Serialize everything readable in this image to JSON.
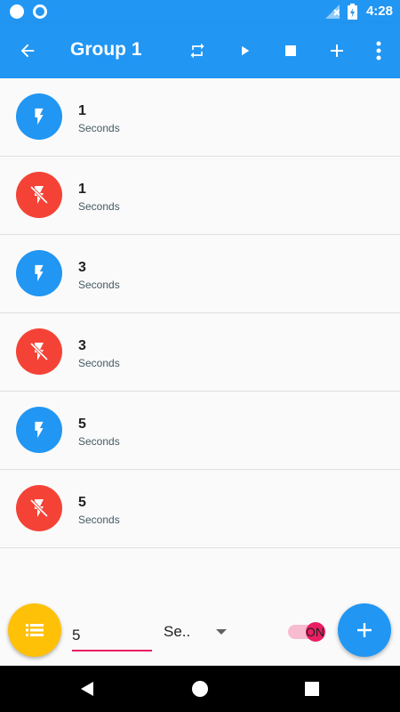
{
  "status_bar": {
    "time": "4:28",
    "left_icons": [
      "circle-icon",
      "circle-outline-icon"
    ],
    "right_icons": [
      "signal-icon",
      "battery-charging-icon"
    ]
  },
  "app_bar": {
    "title": "Group 1",
    "actions": [
      "back-arrow-icon",
      "repeat-icon",
      "play-icon",
      "stop-icon",
      "plus-icon",
      "more-vert-icon"
    ]
  },
  "items": [
    {
      "value": "1",
      "unit": "Seconds",
      "state": "flash-on",
      "color": "#2196f3"
    },
    {
      "value": "1",
      "unit": "Seconds",
      "state": "flash-off",
      "color": "#f44336"
    },
    {
      "value": "3",
      "unit": "Seconds",
      "state": "flash-on",
      "color": "#2196f3"
    },
    {
      "value": "3",
      "unit": "Seconds",
      "state": "flash-off",
      "color": "#f44336"
    },
    {
      "value": "5",
      "unit": "Seconds",
      "state": "flash-on",
      "color": "#2196f3"
    },
    {
      "value": "5",
      "unit": "Seconds",
      "state": "flash-off",
      "color": "#f44336"
    }
  ],
  "bottom_bar": {
    "duration_value": "5",
    "unit_selected": "Se..",
    "toggle_label": "ON",
    "toggle_on": true
  },
  "colors": {
    "primary": "#2196f3",
    "accent": "#e91e63",
    "off": "#f44336",
    "list_fab": "#ffc107"
  }
}
